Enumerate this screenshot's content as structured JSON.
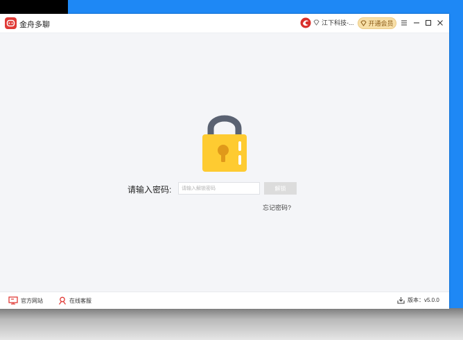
{
  "window": {
    "app_title": "金舟多聊",
    "company": "江下科技-...",
    "vip_label": "开通会员"
  },
  "main": {
    "password_label": "请输入密码:",
    "password_placeholder": "请输入解锁密码",
    "unlock_label": "解锁",
    "forgot_label": "忘记密码?"
  },
  "footer": {
    "website_label": "官方网站",
    "support_label": "在线客服",
    "version_label": "版本：v5.0.0"
  },
  "colors": {
    "brand_red": "#e03a36",
    "lock_body": "#fecb31",
    "lock_shackle": "#5a6272",
    "vip_bg": "#f7dfa8",
    "desktop_blue": "#1e88f5"
  },
  "icons": [
    "app-logo-icon",
    "brand-logo-icon",
    "diamond-icon",
    "vip-diamond-icon",
    "menu-icon",
    "minimize-icon",
    "maximize-icon",
    "close-icon",
    "padlock-icon",
    "monitor-icon",
    "support-person-icon",
    "download-icon"
  ]
}
